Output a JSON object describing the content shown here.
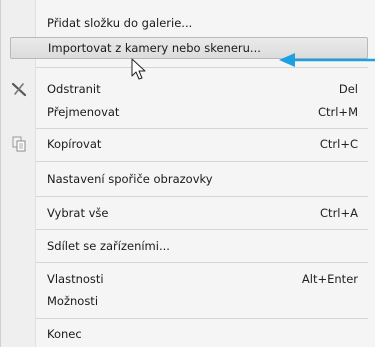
{
  "menu": {
    "items": [
      {
        "label": "Přidat složku do galerie...",
        "shortcut": ""
      },
      {
        "label": "Importovat z kamery nebo skeneru...",
        "shortcut": ""
      },
      {
        "label": "Odstranit",
        "shortcut": "Del"
      },
      {
        "label": "Přejmenovat",
        "shortcut": "Ctrl+M"
      },
      {
        "label": "Kopírovat",
        "shortcut": "Ctrl+C"
      },
      {
        "label": "Nastavení spořiče obrazovky",
        "shortcut": ""
      },
      {
        "label": "Vybrat vše",
        "shortcut": "Ctrl+A"
      },
      {
        "label": "Sdílet se zařízeními...",
        "shortcut": ""
      },
      {
        "label": "Vlastnosti",
        "shortcut": "Alt+Enter"
      },
      {
        "label": "Možnosti",
        "shortcut": ""
      },
      {
        "label": "Konec",
        "shortcut": ""
      }
    ],
    "highlighted_index": 1,
    "icons": {
      "delete": "delete-x-icon",
      "copy": "copy-icon"
    }
  },
  "annotation": {
    "arrow_color": "#1ea0e0",
    "pointer": "mouse-pointer-icon"
  }
}
